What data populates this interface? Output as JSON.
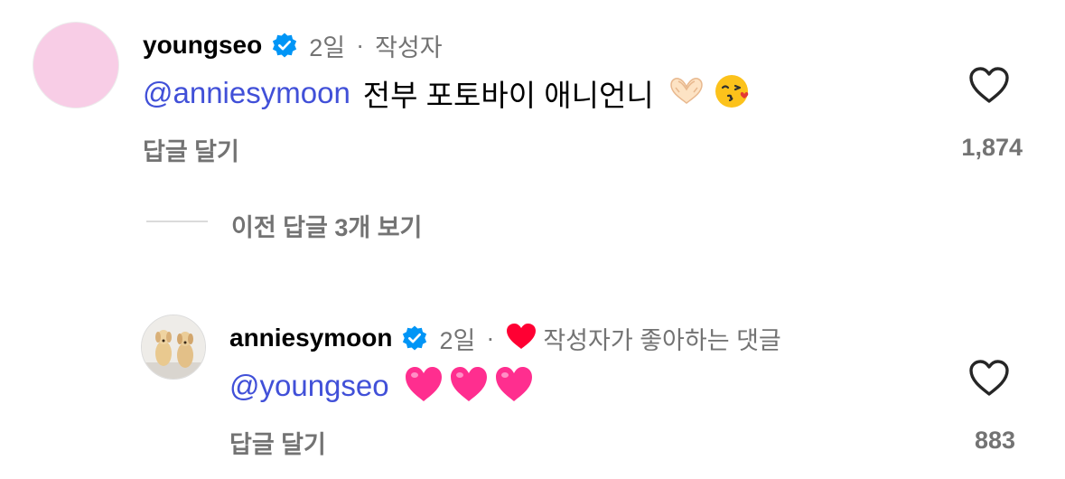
{
  "comments": [
    {
      "username": "youngseo",
      "time": "2일",
      "separator": "·",
      "author_badge": "작성자",
      "mention": "@anniesymoon",
      "text": "전부 포토바이 애니언니",
      "reply_label": "답글 달기",
      "likes": "1,874"
    },
    {
      "username": "anniesymoon",
      "time": "2일",
      "separator": "·",
      "liked_by_author_text": "작성자가 좋아하는 댓글",
      "mention": "@youngseo",
      "reply_label": "답글 달기",
      "likes": "883"
    }
  ],
  "view_replies": "이전 답글 3개 보기",
  "colors": {
    "mention": "#4150d8",
    "verified": "#0095f6",
    "meta": "#737373",
    "author_heart": "#ff0033",
    "pink_heart": "#ff2e8f"
  },
  "icons": [
    "verified-badge-icon",
    "heart-outline-icon",
    "red-heart-icon",
    "heart-hands-emoji",
    "kiss-emoji",
    "pink-heart-emoji"
  ]
}
